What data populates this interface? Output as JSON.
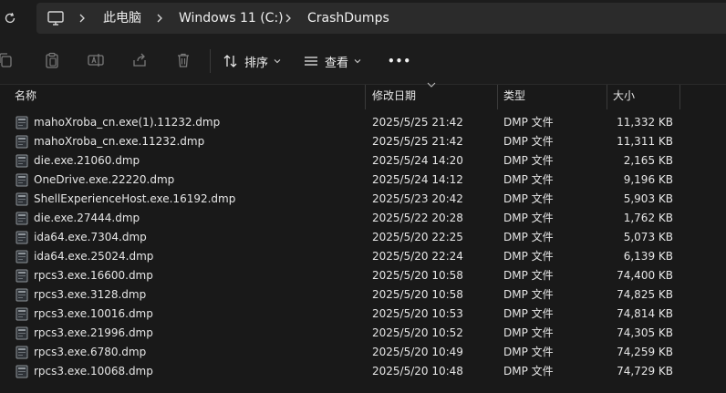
{
  "address_bar": {
    "crumbs": [
      "此电脑",
      "Windows 11 (C:)",
      "CrashDumps"
    ]
  },
  "toolbar": {
    "sort_label": "排序",
    "view_label": "查看",
    "more_label": "•••"
  },
  "columns": {
    "name": "名称",
    "date": "修改日期",
    "type": "类型",
    "size": "大小"
  },
  "files": [
    {
      "name": "mahoXroba_cn.exe(1).11232.dmp",
      "date": "2025/5/25 21:42",
      "type": "DMP 文件",
      "size": "11,332 KB"
    },
    {
      "name": "mahoXroba_cn.exe.11232.dmp",
      "date": "2025/5/25 21:42",
      "type": "DMP 文件",
      "size": "11,311 KB"
    },
    {
      "name": "die.exe.21060.dmp",
      "date": "2025/5/24 14:20",
      "type": "DMP 文件",
      "size": "2,165 KB"
    },
    {
      "name": "OneDrive.exe.22220.dmp",
      "date": "2025/5/24 14:12",
      "type": "DMP 文件",
      "size": "9,196 KB"
    },
    {
      "name": "ShellExperienceHost.exe.16192.dmp",
      "date": "2025/5/23 20:42",
      "type": "DMP 文件",
      "size": "5,903 KB"
    },
    {
      "name": "die.exe.27444.dmp",
      "date": "2025/5/22 20:28",
      "type": "DMP 文件",
      "size": "1,762 KB"
    },
    {
      "name": "ida64.exe.7304.dmp",
      "date": "2025/5/20 22:25",
      "type": "DMP 文件",
      "size": "5,073 KB"
    },
    {
      "name": "ida64.exe.25024.dmp",
      "date": "2025/5/20 22:24",
      "type": "DMP 文件",
      "size": "6,139 KB"
    },
    {
      "name": "rpcs3.exe.16600.dmp",
      "date": "2025/5/20 10:58",
      "type": "DMP 文件",
      "size": "74,400 KB"
    },
    {
      "name": "rpcs3.exe.3128.dmp",
      "date": "2025/5/20 10:58",
      "type": "DMP 文件",
      "size": "74,825 KB"
    },
    {
      "name": "rpcs3.exe.10016.dmp",
      "date": "2025/5/20 10:53",
      "type": "DMP 文件",
      "size": "74,814 KB"
    },
    {
      "name": "rpcs3.exe.21996.dmp",
      "date": "2025/5/20 10:52",
      "type": "DMP 文件",
      "size": "74,305 KB"
    },
    {
      "name": "rpcs3.exe.6780.dmp",
      "date": "2025/5/20 10:49",
      "type": "DMP 文件",
      "size": "74,259 KB"
    },
    {
      "name": "rpcs3.exe.10068.dmp",
      "date": "2025/5/20 10:48",
      "type": "DMP 文件",
      "size": "74,729 KB"
    }
  ]
}
